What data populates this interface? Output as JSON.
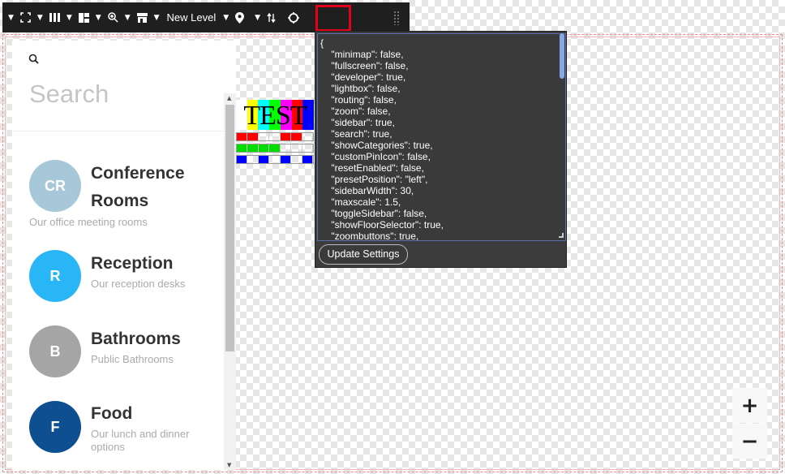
{
  "toolbar": {
    "level_label": "New Level"
  },
  "search": {
    "placeholder": "Search"
  },
  "categories": [
    {
      "initials": "CR",
      "title_line1": "Conference",
      "title_line2": "Rooms",
      "description": "Our office meeting rooms",
      "color": "#a7c8d9"
    },
    {
      "initials": "R",
      "title": "Reception",
      "description": "Our reception desks",
      "color": "#29b6f6"
    },
    {
      "initials": "B",
      "title": "Bathrooms",
      "description": "Public Bathrooms",
      "color": "#a5a5a5"
    },
    {
      "initials": "F",
      "title": "Food",
      "description_line1": "Our lunch and dinner",
      "description_line2": "options",
      "color": "#0d4f91"
    }
  ],
  "test_pattern": {
    "label": "TEST"
  },
  "settings": {
    "json_text": "{\n    \"minimap\": false,\n    \"fullscreen\": false,\n    \"developer\": true,\n    \"lightbox\": false,\n    \"routing\": false,\n    \"zoom\": false,\n    \"sidebar\": true,\n    \"search\": true,\n    \"showCategories\": true,\n    \"customPinIcon\": false,\n    \"resetEnabled\": false,\n    \"presetPosition\": \"left\",\n    \"sidebarWidth\": 30,\n    \"maxscale\": 1.5,\n    \"toggleSidebar\": false,\n    \"showFloorSelector\": true,\n    \"zoombuttons\": true,",
    "update_button": "Update Settings"
  },
  "zoom": {
    "in_label": "+",
    "out_label": "−"
  },
  "colors": {
    "accent_red": "#e2001a",
    "toolbar_bg": "#1f1f1f"
  }
}
